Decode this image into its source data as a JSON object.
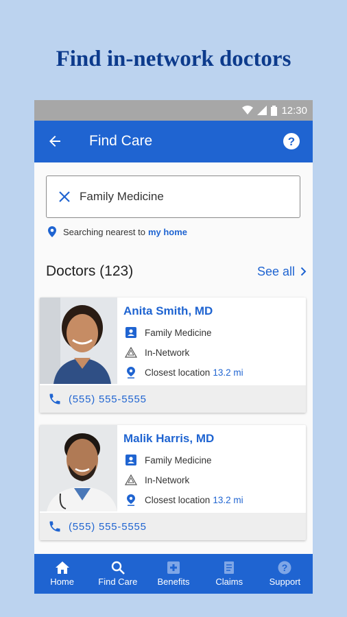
{
  "promo": {
    "headline": "Find in-network doctors"
  },
  "status": {
    "time": "12:30"
  },
  "appbar": {
    "title": "Find Care"
  },
  "search": {
    "value": "Family Medicine",
    "placeholder": ""
  },
  "location": {
    "prefix": "Searching nearest to",
    "link": "my home"
  },
  "doctors": {
    "heading": "Doctors (123)",
    "see_all": "See all",
    "items": [
      {
        "name": "Anita Smith, MD",
        "specialty": "Family Medicine",
        "network": "In-Network",
        "location_label": "Closest location",
        "distance": "13.2 mi",
        "phone": "(555) 555-5555"
      },
      {
        "name": "Malik Harris, MD",
        "specialty": "Family Medicine",
        "network": "In-Network",
        "location_label": "Closest location",
        "distance": "13.2 mi",
        "phone": "(555) 555-5555"
      }
    ]
  },
  "nav": {
    "items": [
      {
        "label": "Home",
        "icon": "home-icon"
      },
      {
        "label": "Find Care",
        "icon": "search-icon"
      },
      {
        "label": "Benefits",
        "icon": "benefits-icon"
      },
      {
        "label": "Claims",
        "icon": "claims-icon"
      },
      {
        "label": "Support",
        "icon": "help-icon"
      }
    ]
  },
  "colors": {
    "primary": "#1f64d1",
    "background": "#bcd3ef",
    "headline": "#0d3b8c"
  }
}
